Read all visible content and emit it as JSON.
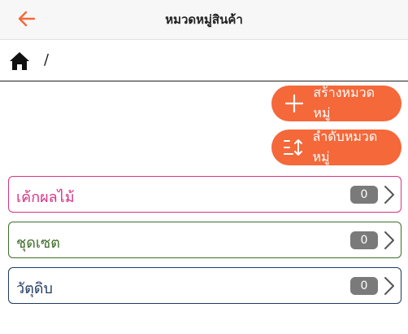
{
  "header": {
    "title": "หมวดหมู่สินค้า",
    "back_icon": "arrow-left-icon",
    "accent_color": "#f4683a"
  },
  "breadcrumb": {
    "home_icon": "home-icon",
    "separator": "/"
  },
  "actions": {
    "create_label": "สร้างหมวดหมู่",
    "create_icon": "plus-icon",
    "order_label": "ลำดับหมวดหมู่",
    "order_icon": "sort-icon",
    "color": "#f4683a"
  },
  "categories": [
    {
      "name": "เค้กผลไม้",
      "count": "0",
      "color": "#d63384"
    },
    {
      "name": "ชุดเซต",
      "count": "0",
      "color": "#3f6d2a"
    },
    {
      "name": "วัตุดิบ",
      "count": "0",
      "color": "#1f3a5f"
    }
  ]
}
